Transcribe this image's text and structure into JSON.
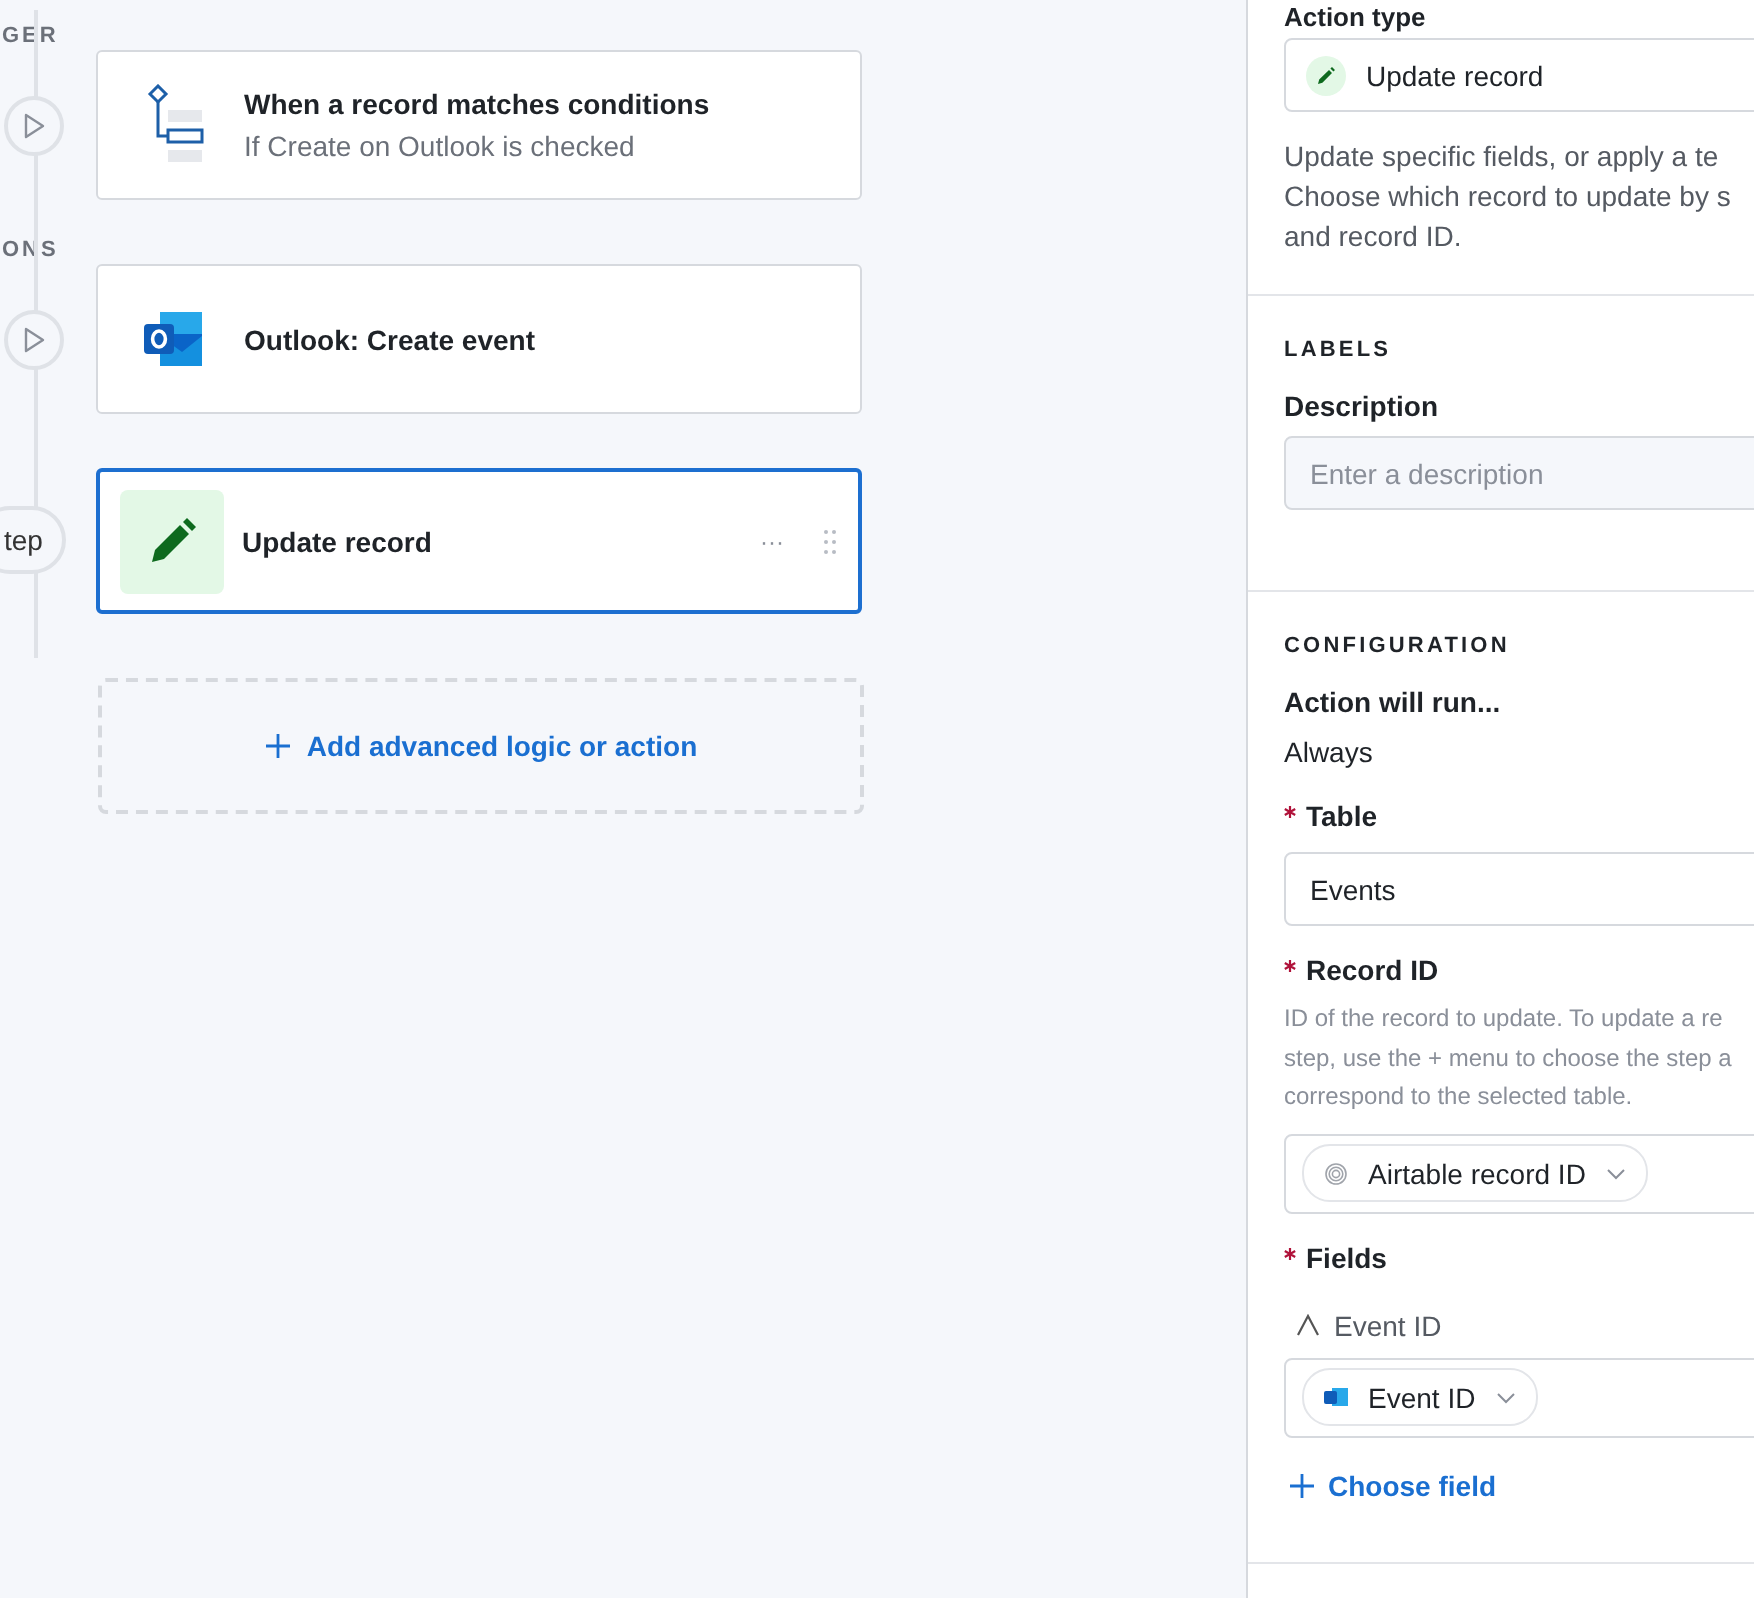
{
  "steps": [
    {
      "section": "GER",
      "kind": "condition",
      "title": "When a record matches conditions",
      "subtitle": "If Create on Outlook is checked",
      "selected": false
    },
    {
      "section": "ONS",
      "kind": "outlook",
      "title": "Outlook: Create event",
      "selected": false
    },
    {
      "marker_text": "tep",
      "kind": "update",
      "title": "Update record",
      "selected": true,
      "menu": "···"
    }
  ],
  "add_action": {
    "label": "Add advanced logic or action"
  },
  "panel": {
    "action_type": {
      "label": "Action type",
      "value": "Update record",
      "description_lines": [
        "Update specific fields, or apply a te",
        "Choose which record to update by s",
        "and record ID."
      ]
    },
    "labels": {
      "heading": "LABELS",
      "description_label": "Description",
      "description_placeholder": "Enter a description"
    },
    "configuration": {
      "heading": "CONFIGURATION",
      "run_label": "Action will run...",
      "run_value": "Always",
      "table": {
        "label": "Table",
        "required": true,
        "value": "Events"
      },
      "record_id": {
        "label": "Record ID",
        "required": true,
        "help_lines": [
          "ID of the record to update. To update a re",
          "step, use the + menu to choose the step a",
          "correspond to the selected table."
        ],
        "token": {
          "label": "Airtable record ID"
        }
      },
      "fields": {
        "label": "Fields",
        "required": true,
        "items": [
          {
            "name": "Event ID",
            "token": {
              "label": "Event ID"
            }
          }
        ],
        "add_label": "Choose field"
      }
    }
  }
}
